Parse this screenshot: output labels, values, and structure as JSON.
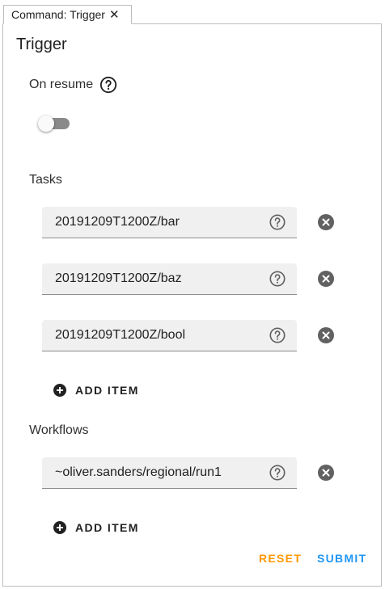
{
  "tab": {
    "label": "Command: Trigger",
    "close_glyph": "✕"
  },
  "form": {
    "title": "Trigger",
    "on_resume": {
      "label": "On resume",
      "enabled": false
    },
    "tasks": {
      "label": "Tasks",
      "items": [
        {
          "value": "20191209T1200Z/bar"
        },
        {
          "value": "20191209T1200Z/baz"
        },
        {
          "value": "20191209T1200Z/bool"
        }
      ],
      "add_label": "ADD ITEM"
    },
    "workflows": {
      "label": "Workflows",
      "items": [
        {
          "value": "~oliver.sanders/regional/run1"
        }
      ],
      "add_label": "ADD ITEM"
    }
  },
  "actions": {
    "reset_label": "RESET",
    "submit_label": "SUBMIT"
  },
  "colors": {
    "reset": "#ff9800",
    "submit": "#2196f3",
    "icon": "#616161",
    "field_bg": "#f0f0f0"
  },
  "icons": {
    "help": "help-circle-outline-icon",
    "remove": "close-circle-icon",
    "add": "plus-circle-icon",
    "close": "close-icon"
  }
}
